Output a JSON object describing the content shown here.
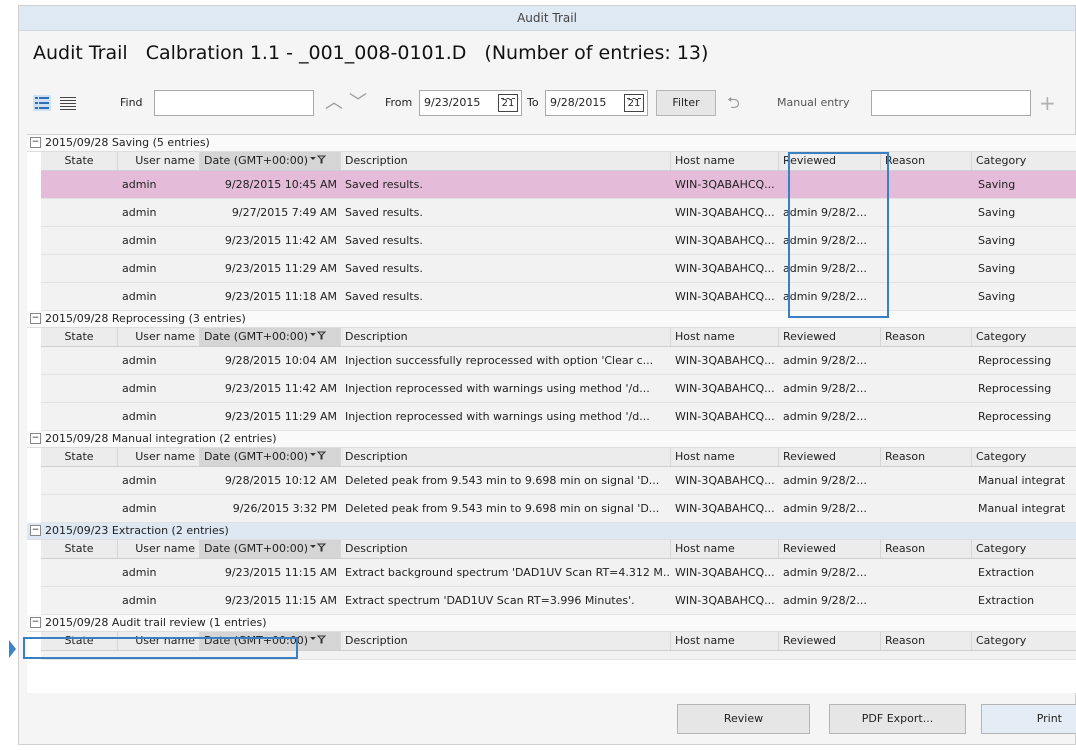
{
  "window": {
    "title": "Audit Trail"
  },
  "heading": {
    "label": "Audit Trail",
    "file": "Calbration 1.1 - _001_008-0101.D",
    "count": "(Number of entries: 13)"
  },
  "toolbar": {
    "find_label": "Find",
    "find_value": "",
    "from_label": "From",
    "from_value": "9/23/2015",
    "to_label": "To",
    "to_value": "9/28/2015",
    "calendar_day": "21",
    "filter_label": "Filter",
    "manual_entry_label": "Manual entry",
    "manual_entry_value": "",
    "add_glyph": "+"
  },
  "columns": {
    "state": "State",
    "user": "User name",
    "date": "Date (GMT+00:00)",
    "description": "Description",
    "host": "Host name",
    "reviewed": "Reviewed",
    "reason": "Reason",
    "category": "Category"
  },
  "groups": [
    {
      "header": "2015/09/28 Saving  (5 entries)",
      "rows": [
        {
          "user": "admin",
          "date": "9/28/2015 10:45 AM",
          "description": "Saved results.",
          "host": "WIN-3QABAHCQ...",
          "reviewed": "",
          "reason": "",
          "category": "Saving"
        },
        {
          "user": "admin",
          "date": "9/27/2015 7:49 AM",
          "description": "Saved results.",
          "host": "WIN-3QABAHCQ...",
          "reviewed": "admin 9/28/2...",
          "reason": "",
          "category": "Saving"
        },
        {
          "user": "admin",
          "date": "9/23/2015 11:42 AM",
          "description": "Saved results.",
          "host": "WIN-3QABAHCQ...",
          "reviewed": "admin 9/28/2...",
          "reason": "",
          "category": "Saving"
        },
        {
          "user": "admin",
          "date": "9/23/2015 11:29 AM",
          "description": "Saved results.",
          "host": "WIN-3QABAHCQ...",
          "reviewed": "admin 9/28/2...",
          "reason": "",
          "category": "Saving"
        },
        {
          "user": "admin",
          "date": "9/23/2015 11:18 AM",
          "description": "Saved results.",
          "host": "WIN-3QABAHCQ...",
          "reviewed": "admin 9/28/2...",
          "reason": "",
          "category": "Saving"
        }
      ]
    },
    {
      "header": "2015/09/28 Reprocessing  (3 entries)",
      "rows": [
        {
          "user": "admin",
          "date": "9/28/2015 10:04 AM",
          "description": "Injection successfully reprocessed with option 'Clear c...",
          "host": "WIN-3QABAHCQ...",
          "reviewed": "admin 9/28/2...",
          "reason": "",
          "category": "Reprocessing"
        },
        {
          "user": "admin",
          "date": "9/23/2015 11:42 AM",
          "description": "Injection reprocessed with warnings using method '/d...",
          "host": "WIN-3QABAHCQ...",
          "reviewed": "admin 9/28/2...",
          "reason": "",
          "category": "Reprocessing"
        },
        {
          "user": "admin",
          "date": "9/23/2015 11:29 AM",
          "description": "Injection reprocessed with warnings using method '/d...",
          "host": "WIN-3QABAHCQ...",
          "reviewed": "admin 9/28/2...",
          "reason": "",
          "category": "Reprocessing"
        }
      ]
    },
    {
      "header": "2015/09/28 Manual integration  (2 entries)",
      "rows": [
        {
          "user": "admin",
          "date": "9/28/2015 10:12 AM",
          "description": "Deleted peak from 9.543 min to 9.698 min on signal 'D...",
          "host": "WIN-3QABAHCQ...",
          "reviewed": "admin 9/28/2...",
          "reason": "",
          "category": "Manual integrat"
        },
        {
          "user": "admin",
          "date": "9/26/2015 3:32 PM",
          "description": "Deleted peak from 9.543 min to 9.698 min on signal 'D...",
          "host": "WIN-3QABAHCQ...",
          "reviewed": "admin 9/28/2...",
          "reason": "",
          "category": "Manual integrat"
        }
      ]
    },
    {
      "header": "2015/09/23 Extraction  (2 entries)",
      "rows": [
        {
          "user": "admin",
          "date": "9/23/2015 11:15 AM",
          "description": "Extract background spectrum 'DAD1UV Scan RT=4.312 M...",
          "host": "WIN-3QABAHCQ...",
          "reviewed": "admin 9/28/2...",
          "reason": "",
          "category": "Extraction"
        },
        {
          "user": "admin",
          "date": "9/23/2015 11:15 AM",
          "description": "Extract spectrum 'DAD1UV Scan RT=3.996 Minutes'.",
          "host": "WIN-3QABAHCQ...",
          "reviewed": "admin 9/28/2...",
          "reason": "",
          "category": "Extraction"
        }
      ]
    },
    {
      "header": "2015/09/28 Audit trail review  (1 entries)",
      "rows": [
        {
          "user": "",
          "date": "",
          "description": "",
          "host": "",
          "reviewed": "",
          "reason": "",
          "category": ""
        }
      ]
    }
  ],
  "footer": {
    "review": "Review",
    "pdf_export": "PDF Export...",
    "print": "Print"
  },
  "colors": {
    "highlight_row": "#e4bcd9",
    "accent_box": "#3a7fc2",
    "titlebar": "#dfe9f3"
  }
}
